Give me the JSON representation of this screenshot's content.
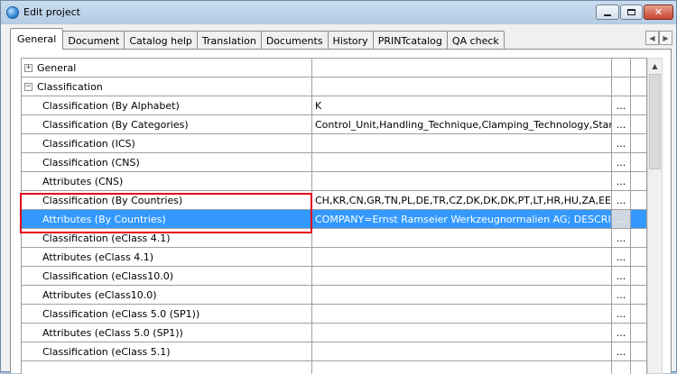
{
  "window": {
    "title": "Edit project",
    "close_glyph": "✕"
  },
  "tabs": [
    {
      "label": "General",
      "active": true
    },
    {
      "label": "Document"
    },
    {
      "label": "Catalog help"
    },
    {
      "label": "Translation"
    },
    {
      "label": "Documents"
    },
    {
      "label": "History"
    },
    {
      "label": "PRINTcatalog"
    },
    {
      "label": "QA check"
    }
  ],
  "tab_scroll": {
    "left": "◀",
    "right": "▶"
  },
  "grid": {
    "groups": [
      {
        "expander": "+",
        "label": "General"
      },
      {
        "expander": "−",
        "label": "Classification"
      }
    ],
    "rows": [
      {
        "name": "Classification (By Alphabet)",
        "value": "K",
        "button": "..."
      },
      {
        "name": "Classification (By Categories)",
        "value": "Control_Unit,Handling_Technique,Clamping_Technology,Standard_F",
        "button": "..."
      },
      {
        "name": "Classification (ICS)",
        "value": "",
        "button": "..."
      },
      {
        "name": "Classification (CNS)",
        "value": "",
        "button": "..."
      },
      {
        "name": "Attributes (CNS)",
        "value": "",
        "button": "..."
      },
      {
        "name": "Classification (By Countries)",
        "value": "CH,KR,CN,GR,TN,PL,DE,TR,CZ,DK,DK,DK,PT,LT,HR,HU,ZA,EE,US,IL,INS...",
        "button": "..."
      },
      {
        "name": "Attributes (By Countries)",
        "value": "COMPANY=Ernst Ramseier Werkzeugnormalien AG; DESCRIPTION=)...",
        "button": "...",
        "selected": true
      },
      {
        "name": "Classification (eClass 4.1)",
        "value": "",
        "button": "..."
      },
      {
        "name": "Attributes (eClass 4.1)",
        "value": "",
        "button": "..."
      },
      {
        "name": "Classification (eClass10.0)",
        "value": "",
        "button": "..."
      },
      {
        "name": "Attributes (eClass10.0)",
        "value": "",
        "button": "..."
      },
      {
        "name": "Classification (eClass 5.0 (SP1))",
        "value": "",
        "button": "..."
      },
      {
        "name": "Attributes (eClass 5.0 (SP1))",
        "value": "",
        "button": "..."
      },
      {
        "name": "Classification (eClass 5.1)",
        "value": "",
        "button": "..."
      },
      {
        "name": "",
        "value": "",
        "button": ""
      }
    ]
  },
  "scrollbar": {
    "up_arrow": "▲"
  },
  "colors": {
    "selection": "#3399ff",
    "highlight_box": "#e3001b"
  }
}
